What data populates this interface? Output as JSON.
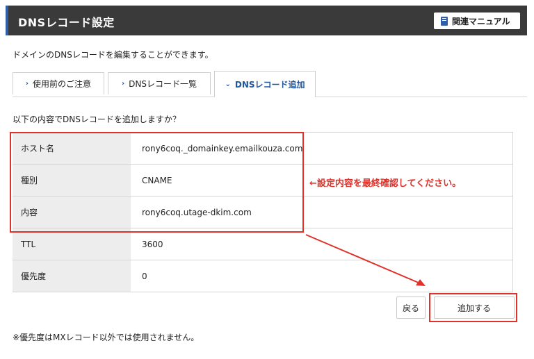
{
  "header": {
    "title": "DNSレコード設定",
    "manual_label": "関連マニュアル"
  },
  "description": "ドメインのDNSレコードを編集することができます。",
  "tabs": [
    {
      "label": "使用前のご注意",
      "active": false
    },
    {
      "label": "DNSレコード一覧",
      "active": false
    },
    {
      "label": "DNSレコード追加",
      "active": true
    }
  ],
  "confirm_message": "以下の内容でDNSレコードを追加しますか？",
  "records": [
    {
      "key": "ホスト名",
      "value": "rony6coq._domainkey.emailkouza.com"
    },
    {
      "key": "種別",
      "value": "CNAME"
    },
    {
      "key": "内容",
      "value": "rony6coq.utage-dkim.com"
    },
    {
      "key": "TTL",
      "value": "3600"
    },
    {
      "key": "優先度",
      "value": "0"
    }
  ],
  "annotation": "←設定内容を最終確認してください。",
  "buttons": {
    "back": "戻る",
    "add": "追加する"
  },
  "note": "※優先度はMXレコード以外では使用されません。",
  "colors": {
    "header_bg": "#3a3a3a",
    "accent_blue": "#2e5fa8",
    "highlight_red": "#e0312a"
  }
}
